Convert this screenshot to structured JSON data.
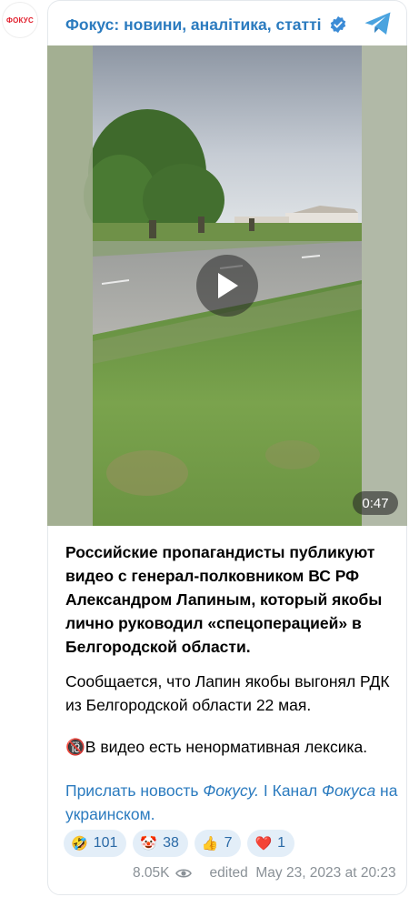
{
  "channel": {
    "avatar_text": "ФОКУС",
    "title": "Фокус: новини, аналітика, статті"
  },
  "video": {
    "duration": "0:47"
  },
  "message": {
    "paragraph1": "Российские пропагандисты публикуют видео с генерал-полковником ВС РФ Александром Лапиным, который якобы лично руководил «спецоперацией» в Белгородской области.",
    "paragraph2": "Сообщается, что Лапин якобы выгонял РДК из Белгородской области 22 мая.",
    "paragraph3_badge": "🔞",
    "paragraph3": "В видео есть ненормативная лексика.",
    "links": {
      "send_news": "Прислать новость ",
      "send_news_italic": "Фокусу.",
      "separator": " I ",
      "channel": "Канал ",
      "channel_italic": "Фокуса",
      "channel_rest": " на украинском."
    }
  },
  "reactions": [
    {
      "emoji": "🤣",
      "icon": "rofl-emoji",
      "count": "101"
    },
    {
      "emoji": "🤡",
      "icon": "clown-emoji",
      "count": "38"
    },
    {
      "emoji": "👍",
      "icon": "thumbs-up-emoji",
      "count": "7"
    },
    {
      "emoji": "❤️",
      "icon": "heart-emoji",
      "count": "1"
    }
  ],
  "footer": {
    "views": "8.05K",
    "edited": "edited  May 23, 2023 at 20:23"
  },
  "colors": {
    "link": "#2b7bbf",
    "reaction_bg": "#e3eef8",
    "brand_red": "#e11d2b"
  }
}
